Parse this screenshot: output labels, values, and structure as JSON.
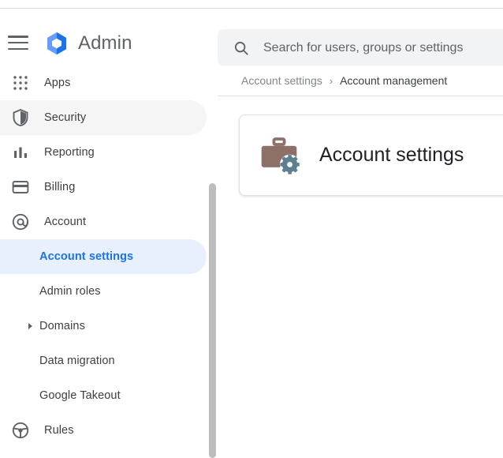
{
  "header": {
    "menu_icon": "hamburger-menu-icon",
    "logo_icon": "google-admin-logo-icon",
    "brand": "Admin",
    "search": {
      "icon": "search-icon",
      "placeholder": "Search for users, groups or settings",
      "value": ""
    }
  },
  "sidebar": {
    "items": [
      {
        "label": "Apps",
        "icon": "apps-grid-icon",
        "state": "default",
        "level": 0
      },
      {
        "label": "Security",
        "icon": "shield-icon",
        "state": "hovered",
        "level": 0
      },
      {
        "label": "Reporting",
        "icon": "bar-chart-icon",
        "state": "default",
        "level": 0
      },
      {
        "label": "Billing",
        "icon": "credit-card-icon",
        "state": "default",
        "level": 0
      },
      {
        "label": "Account",
        "icon": "at-sign-icon",
        "state": "default",
        "level": 0
      },
      {
        "label": "Account settings",
        "icon": "",
        "state": "selected",
        "level": 1
      },
      {
        "label": "Admin roles",
        "icon": "",
        "state": "default",
        "level": 1
      },
      {
        "label": "Domains",
        "icon": "",
        "state": "default",
        "level": 1,
        "expandable": true
      },
      {
        "label": "Data migration",
        "icon": "",
        "state": "default",
        "level": 1
      },
      {
        "label": "Google Takeout",
        "icon": "",
        "state": "default",
        "level": 1
      },
      {
        "label": "Rules",
        "icon": "steering-wheel-icon",
        "state": "default",
        "level": 0
      }
    ],
    "scrollbar": "vertical-scrollbar-thumb"
  },
  "main": {
    "breadcrumb": {
      "previous": "Account settings",
      "separator": "›",
      "current": "Account management"
    },
    "card": {
      "icon": "briefcase-gear-icon",
      "title": "Account settings"
    }
  },
  "colors": {
    "accent_blue": "#1a73e8",
    "accent_blue_light": "#669df6",
    "selected_bg": "#e8f0fe",
    "hover_bg": "#f5f5f5",
    "search_bg": "#f1f3f4",
    "text_primary": "#3c4043",
    "text_secondary": "#80868b",
    "briefcase_brown": "#8d7068",
    "gear_blue_gray": "#5d7f91",
    "border": "#e0e0e0"
  }
}
